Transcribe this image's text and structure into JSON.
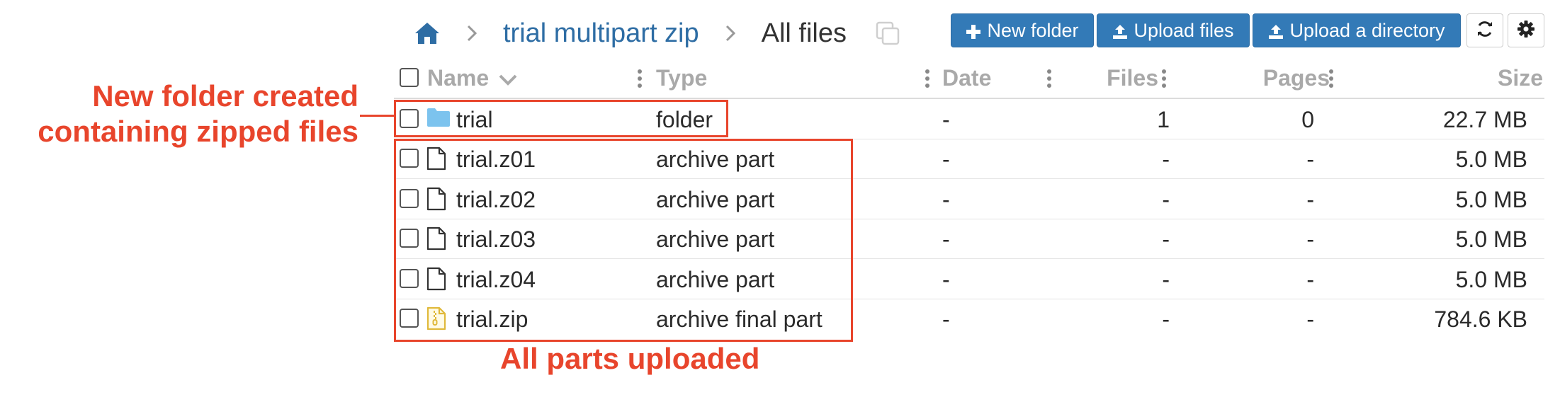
{
  "breadcrumb": {
    "home_icon": "home-icon",
    "project": "trial multipart zip",
    "current": "All files",
    "link_color": "#2e6da4"
  },
  "toolbar": {
    "new_folder_label": "New folder",
    "upload_files_label": "Upload files",
    "upload_directory_label": "Upload a directory",
    "refresh_icon": "refresh-icon",
    "settings_icon": "gear-icon",
    "button_color": "#337ab7"
  },
  "table": {
    "headers": {
      "name": "Name",
      "type": "Type",
      "date": "Date",
      "files": "Files",
      "pages": "Pages",
      "size": "Size"
    },
    "rows": [
      {
        "name": "trial",
        "icon": "folder-icon",
        "type": "folder",
        "date": "-",
        "files": "1",
        "pages": "0",
        "size": "22.7 MB"
      },
      {
        "name": "trial.z01",
        "icon": "file-icon",
        "type": "archive part",
        "date": "-",
        "files": "-",
        "pages": "-",
        "size": "5.0 MB"
      },
      {
        "name": "trial.z02",
        "icon": "file-icon",
        "type": "archive part",
        "date": "-",
        "files": "-",
        "pages": "-",
        "size": "5.0 MB"
      },
      {
        "name": "trial.z03",
        "icon": "file-icon",
        "type": "archive part",
        "date": "-",
        "files": "-",
        "pages": "-",
        "size": "5.0 MB"
      },
      {
        "name": "trial.z04",
        "icon": "file-icon",
        "type": "archive part",
        "date": "-",
        "files": "-",
        "pages": "-",
        "size": "5.0 MB"
      },
      {
        "name": "trial.zip",
        "icon": "zip-file-icon",
        "type": "archive final part",
        "date": "-",
        "files": "-",
        "pages": "-",
        "size": "784.6 KB"
      }
    ]
  },
  "annotations": {
    "folder_note_line1": "New folder created",
    "folder_note_line2": "containing zipped files",
    "parts_note": "All parts uploaded",
    "color": "#e8452c"
  }
}
